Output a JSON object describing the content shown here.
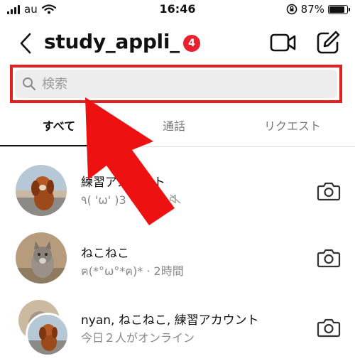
{
  "status_bar": {
    "carrier": "au",
    "time": "16:46",
    "battery_percent": "87%",
    "battery_level": 0.87
  },
  "header": {
    "title": "study_appli_",
    "badge_count": "4"
  },
  "search": {
    "placeholder": "検索",
    "value": ""
  },
  "tabs": [
    {
      "label": "すべて",
      "active": true
    },
    {
      "label": "通話",
      "active": false
    },
    {
      "label": "リクエスト",
      "active": false
    }
  ],
  "conversations": [
    {
      "name": "練習アカウント",
      "meta": "٩( 'ω' )و · 3時間"
    },
    {
      "name": "ねこねこ",
      "meta": "ฅ(*°ω°*ฅ)* · 2時間"
    },
    {
      "name": "nyan, ねこねこ, 練習アカウント",
      "meta": "今日２人がオンライン"
    }
  ],
  "colors": {
    "highlight": "#e3201d",
    "badge": "#e8212e",
    "arrow": "#ee1111"
  }
}
